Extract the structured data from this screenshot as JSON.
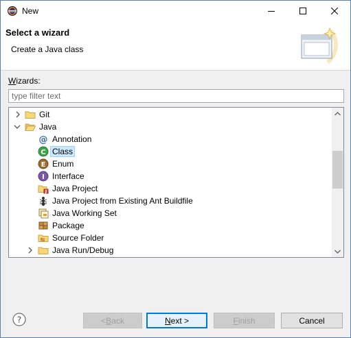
{
  "window": {
    "title": "New",
    "icon": "eclipse-icon"
  },
  "banner": {
    "title": "Select a wizard",
    "description": "Create a Java class",
    "graphic": "wizard-banner-graphic"
  },
  "wizards": {
    "label_mnemonic": "W",
    "label_rest": "izards:",
    "filter_placeholder": "type filter text",
    "filter_value": ""
  },
  "tree": {
    "items": [
      {
        "label": "Git",
        "icon": "folder-icon",
        "twisty": "collapsed",
        "level": 0
      },
      {
        "label": "Java",
        "icon": "folder-open-icon",
        "twisty": "expanded",
        "level": 0
      },
      {
        "label": "Annotation",
        "icon": "annotation-icon",
        "twisty": "none",
        "level": 1
      },
      {
        "label": "Class",
        "icon": "class-icon",
        "twisty": "none",
        "level": 1,
        "selected": true
      },
      {
        "label": "Enum",
        "icon": "enum-icon",
        "twisty": "none",
        "level": 1
      },
      {
        "label": "Interface",
        "icon": "interface-icon",
        "twisty": "none",
        "level": 1
      },
      {
        "label": "Java Project",
        "icon": "java-project-icon",
        "twisty": "none",
        "level": 1
      },
      {
        "label": "Java Project from Existing Ant Buildfile",
        "icon": "ant-icon",
        "twisty": "none",
        "level": 1
      },
      {
        "label": "Java Working Set",
        "icon": "working-set-icon",
        "twisty": "none",
        "level": 1
      },
      {
        "label": "Package",
        "icon": "package-icon",
        "twisty": "none",
        "level": 1
      },
      {
        "label": "Source Folder",
        "icon": "source-folder-icon",
        "twisty": "none",
        "level": 1
      },
      {
        "label": "Java Run/Debug",
        "icon": "folder-icon",
        "twisty": "collapsed",
        "level": 1
      }
    ]
  },
  "buttons": {
    "back_mnemonic": "B",
    "back_prefix": "< ",
    "back_rest": "ack",
    "next_mnemonic": "N",
    "next_rest": "ext >",
    "finish_mnemonic": "F",
    "finish_rest": "inish",
    "cancel": "Cancel"
  },
  "colors": {
    "selection": "#cce8ff",
    "accent": "#0078d7"
  }
}
